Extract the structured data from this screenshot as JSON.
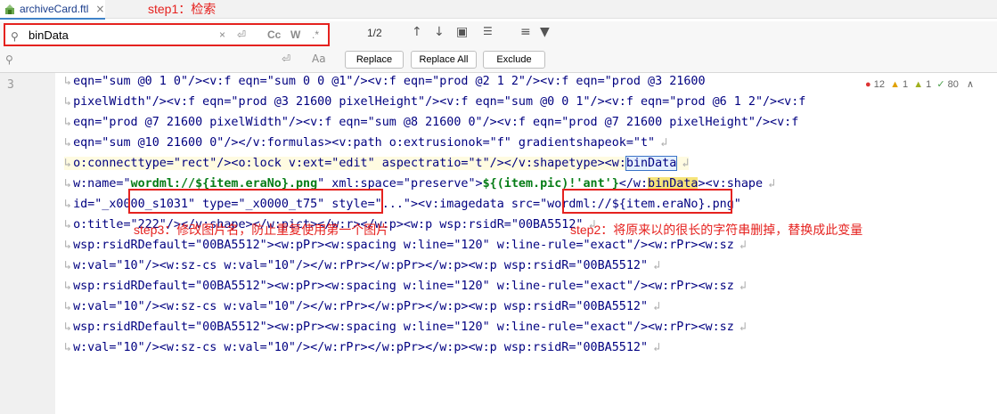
{
  "tab": {
    "label": "archiveCard.ftl",
    "close": "×"
  },
  "annotations": {
    "step1": "step1：检索",
    "step2": "step2：将原来以的很长的字符串删掉，替换成此变量",
    "step3": "step3：修改图片名，防止重复使用第一个图片"
  },
  "search": {
    "value": "binData",
    "replace_placeholder": "",
    "match_count": "1/2",
    "opts": {
      "cc": "Cc",
      "w": "W",
      "regex": ".*"
    },
    "replace_btn": "Replace",
    "replace_all_btn": "Replace All",
    "exclude_btn": "Exclude"
  },
  "gutter": {
    "line_number": "3"
  },
  "inspections": {
    "errors": "12",
    "warnings": "1",
    "weak": "1",
    "ok": "80"
  },
  "code": {
    "lines": [
      "eqn=\"sum @0 1 0\"/><v:f eqn=\"sum 0 0 @1\"/><v:f eqn=\"prod @2 1 2\"/><v:f eqn=\"prod @3 21600",
      "pixelWidth\"/><v:f eqn=\"prod @3 21600 pixelHeight\"/><v:f eqn=\"sum @0 0 1\"/><v:f eqn=\"prod @6 1 2\"/><v:f",
      "eqn=\"prod @7 21600 pixelWidth\"/><v:f eqn=\"sum @8 21600 0\"/><v:f eqn=\"prod @7 21600 pixelHeight\"/><v:f",
      "eqn=\"sum @10 21600 0\"/></v:formulas><v:path o:extrusionok=\"f\" gradientshapeok=\"t\"",
      "o:connecttype=\"rect\"/><o:lock v:ext=\"edit\" aspectratio=\"t\"/></v:shapetype><w:",
      "w:name=\"",
      "id=\"_x0000_s1031\" type=\"_x0000_t75\" style=\"...\"><v:imagedata src=\"wordml://${item.eraNo}.png\"",
      "o:title=\"222\"/></v:shape></w:pict></w:r></w:p><w:p wsp:rsidR=\"00BA5512\"",
      "wsp:rsidRDefault=\"00BA5512\"><w:pPr><w:spacing w:line=\"120\" w:line-rule=\"exact\"/><w:rPr><w:sz",
      "w:val=\"10\"/><w:sz-cs w:val=\"10\"/></w:rPr></w:pPr></w:p><w:p wsp:rsidR=\"00BA5512\"",
      "wsp:rsidRDefault=\"00BA5512\"><w:pPr><w:spacing w:line=\"120\" w:line-rule=\"exact\"/><w:rPr><w:sz",
      "w:val=\"10\"/><w:sz-cs w:val=\"10\"/></w:rPr></w:pPr></w:p><w:p wsp:rsidR=\"00BA5512\"",
      "wsp:rsidRDefault=\"00BA5512\"><w:pPr><w:spacing w:line=\"120\" w:line-rule=\"exact\"/><w:rPr><w:sz",
      "w:val=\"10\"/><w:sz-cs w:val=\"10\"/></w:rPr></w:pPr></w:p><w:p wsp:rsidR=\"00BA5512\""
    ],
    "line5_match": "binData",
    "line6_name_value": "wordml://${item.eraNo}.png",
    "line6_mid": " xml:space=\"preserve\">",
    "line6_expr": "${(item.pic)!'ant'}",
    "line6_close_open": "</w:",
    "line6_match": "binData",
    "line6_tail": "><v:shape"
  },
  "colors": {
    "annotation_red": "#e5221f",
    "match_bg": "#f6e479",
    "current_match_bg": "#e5f0ff"
  }
}
